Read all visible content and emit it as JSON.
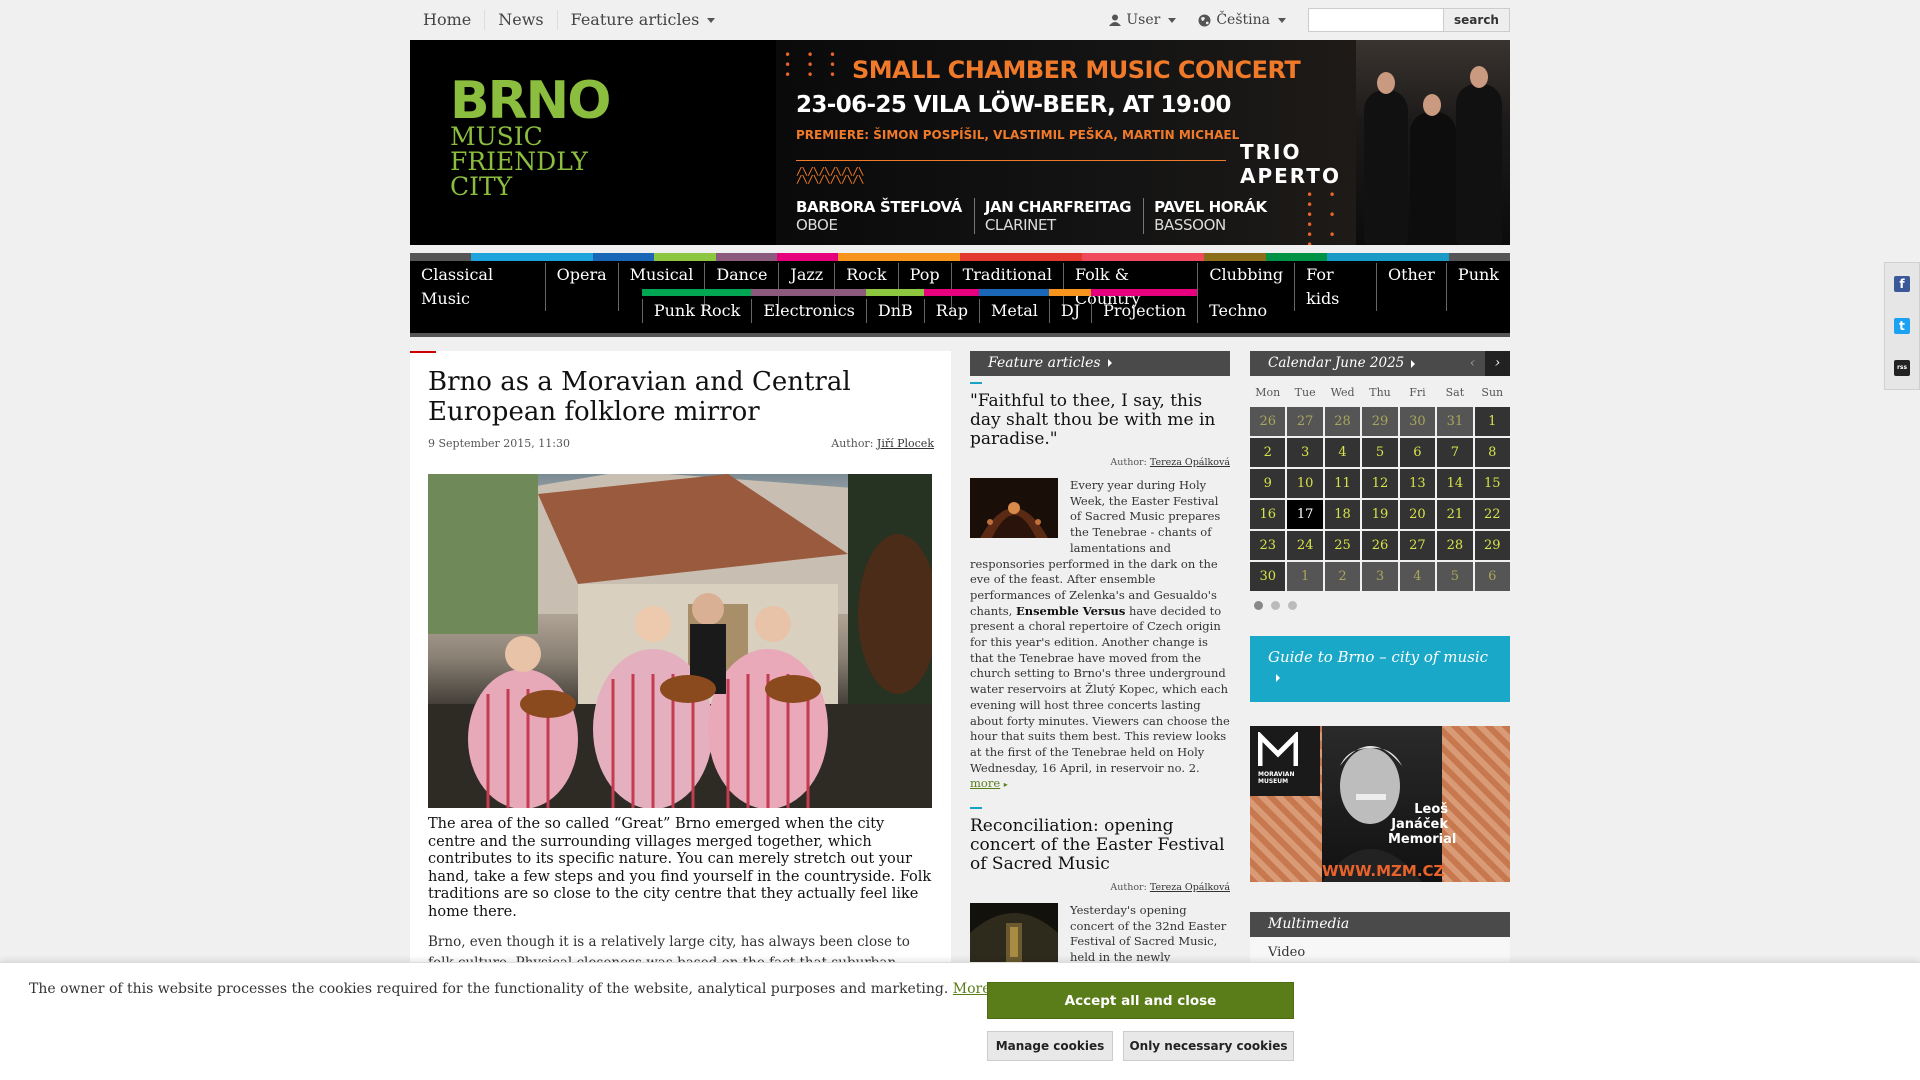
{
  "topbar": {
    "nav": [
      "Home",
      "News",
      "Feature articles"
    ],
    "user_label": "User",
    "lang_label": "Čeština",
    "search_placeholder": "",
    "search_button": "search"
  },
  "banner": {
    "logo_word": "BRNO",
    "logo_lines": [
      "MUSIC",
      "FRIENDLY",
      "CITY"
    ],
    "concert_title": "SMALL CHAMBER MUSIC CONCERT",
    "concert_date": "23-06-25 VILA LÖW-BEER, AT 19:00",
    "premiere": "PREMIERE: ŠIMON POSPÍŠIL, VLASTIMIL PEŠKA, MARTIN MICHAEL",
    "trio_line1": "TRIO",
    "trio_line2": "APERTO",
    "musicians": [
      {
        "name": "BARBORA ŠTEFLOVÁ",
        "instrument": "OBOE"
      },
      {
        "name": "JAN CHARFREITAG",
        "instrument": "CLARINET"
      },
      {
        "name": "PAVEL HORÁK",
        "instrument": "BASSOON"
      }
    ]
  },
  "genres": {
    "row1": [
      "Classical Music",
      "Opera",
      "Musical",
      "Dance",
      "Jazz",
      "Rock",
      "Pop",
      "Traditional",
      "Folk & Country",
      "Clubbing",
      "For kids",
      "Other",
      "Punk"
    ],
    "row2": [
      "Punk Rock",
      "Electronics",
      "DnB",
      "Rap",
      "Metal",
      "DJ",
      "Projection",
      "Techno"
    ],
    "stripe_colors": [
      "#555555",
      "#1fa3dd",
      "#1fa3dd",
      "#1a67b8",
      "#8dc63f",
      "#8b5a7c",
      "#e6007e",
      "#f7941d",
      "#f7941d",
      "#e23a2e",
      "#e23a2e",
      "#ef4b5c",
      "#ef4b5c",
      "#8b6d1a",
      "#009245",
      "#1a9ac7",
      "#1a9ac7",
      "#555555"
    ],
    "row2_colors": [
      "#00a651",
      "#8b5a7c",
      "#8dc63f",
      "#e6007e",
      "#1a67b8",
      "#f7941d",
      "#e6007e"
    ]
  },
  "article": {
    "title": "Brno as a Moravian and Central European folklore mirror",
    "date": "9 September 2015, 11:30",
    "author_label": "Author:",
    "author": "Jiří Plocek",
    "lead": "The area of the so called “Great” Brno emerged when the city centre and the surrounding villages merged together, which contributes to its specific nature. You can merely stretch out your hand, take a few steps and you find yourself in the countryside. Folk traditions are so close to the city centre that they actually feel like home there.",
    "body": "Brno, even though it is a relatively large city, has always been close to folk culture. Physical closeness was based on the fact that suburban municipalities – such as Bohunice, Židenice (and also Juliánov), Jundrov or Líšeň, had their"
  },
  "features": {
    "heading": "Feature articles",
    "items": [
      {
        "title": "\"Faithful to thee, I say, this day shalt thou be with me in paradise.\"",
        "author_label": "Author:",
        "author": "Tereza Opálková",
        "text_before": "Every year during Holy Week, the Easter Festival of Sacred Music prepares the Tenebrae - chants of lamentations and responsories performed in the dark on the eve of the feast. After ensemble performances of Zelenka's and Gesualdo's chants, ",
        "text_bold": "Ensemble Versus",
        "text_after": " have decided to present a choral repertoire of Czech origin for this year's edition. Another change is that the Tenebrae have moved from the church setting to Brno's three underground water reservoirs at Žlutý Kopec, which each evening will host three concerts lasting about forty minutes. Viewers can choose the hour that suits them best. This review looks at the first of the Tenebrae held on Holy Wednesday, 16 April, in reservoir no. 2.",
        "more": "more"
      },
      {
        "title": "Reconciliation: opening concert of the Easter Festival of Sacred Music",
        "author_label": "Author:",
        "author": "Tereza Opálková",
        "text": "Yesterday's opening concert of the 32nd Easter Festival of Sacred Music, held in the newly renovated Church of St. James, offered more than an hour of contemplation with the St. John Passion"
      }
    ]
  },
  "calendar": {
    "title": "Calendar June 2025",
    "prev": "‹",
    "next": "›",
    "dow": [
      "Mon",
      "Tue",
      "Wed",
      "Thu",
      "Fri",
      "Sat",
      "Sun"
    ],
    "days": [
      {
        "d": "26",
        "o": true
      },
      {
        "d": "27",
        "o": true
      },
      {
        "d": "28",
        "o": true
      },
      {
        "d": "29",
        "o": true
      },
      {
        "d": "30",
        "o": true
      },
      {
        "d": "31",
        "o": true
      },
      {
        "d": "1"
      },
      {
        "d": "2"
      },
      {
        "d": "3"
      },
      {
        "d": "4"
      },
      {
        "d": "5"
      },
      {
        "d": "6"
      },
      {
        "d": "7"
      },
      {
        "d": "8"
      },
      {
        "d": "9"
      },
      {
        "d": "10"
      },
      {
        "d": "11"
      },
      {
        "d": "12"
      },
      {
        "d": "13"
      },
      {
        "d": "14"
      },
      {
        "d": "15"
      },
      {
        "d": "16"
      },
      {
        "d": "17",
        "t": true
      },
      {
        "d": "18"
      },
      {
        "d": "19"
      },
      {
        "d": "20"
      },
      {
        "d": "21"
      },
      {
        "d": "22"
      },
      {
        "d": "23"
      },
      {
        "d": "24"
      },
      {
        "d": "25"
      },
      {
        "d": "26"
      },
      {
        "d": "27"
      },
      {
        "d": "28"
      },
      {
        "d": "29"
      },
      {
        "d": "30"
      },
      {
        "d": "1",
        "o": true
      },
      {
        "d": "2",
        "o": true
      },
      {
        "d": "3",
        "o": true
      },
      {
        "d": "4",
        "o": true
      },
      {
        "d": "5",
        "o": true
      },
      {
        "d": "6",
        "o": true
      }
    ]
  },
  "guide": {
    "label": "Guide to Brno – city of music"
  },
  "museum": {
    "label_line1": "MORAVIAN",
    "label_line2": "MUSEUM",
    "name_lines": [
      "Leoš",
      "Janáček",
      "Memorial"
    ],
    "url": "WWW.MZM.CZ"
  },
  "multimedia": {
    "heading": "Multimedia",
    "item": "Video"
  },
  "social": [
    "f",
    "t",
    "rss"
  ],
  "cookie": {
    "text": "The owner of this website processes the cookies required for the functionality of the website, analytical purposes and marketing.",
    "more": "More information",
    "accept": "Accept all and close",
    "manage": "Manage cookies",
    "necessary": "Only necessary cookies"
  }
}
